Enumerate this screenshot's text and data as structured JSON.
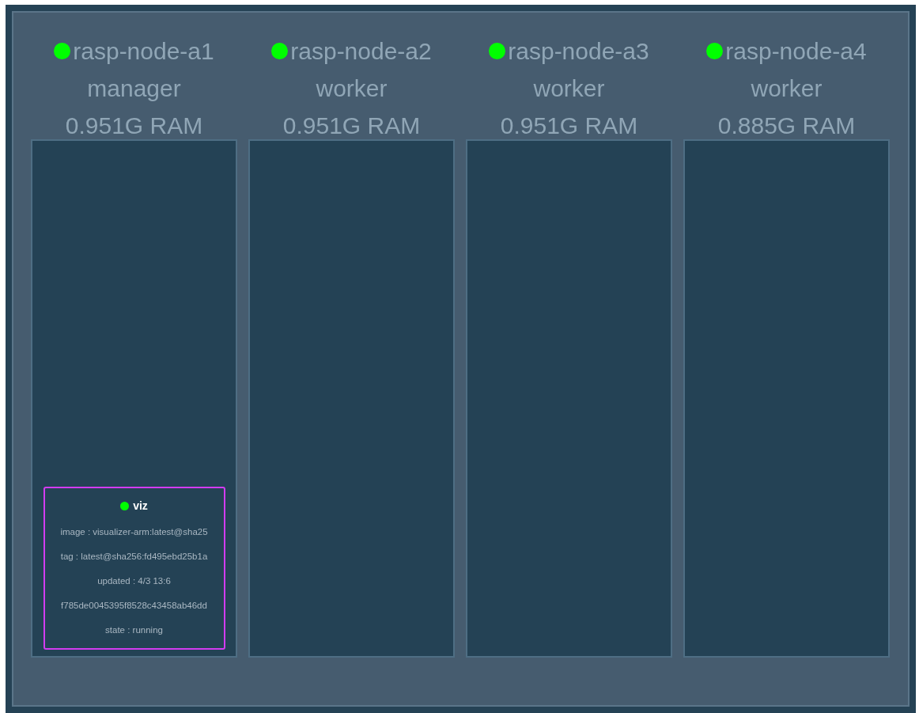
{
  "nodes": [
    {
      "name": "rasp-node-a1",
      "role": "manager",
      "ram": "0.951G RAM",
      "color": "#00ff00",
      "tasks": [
        {
          "name": "viz",
          "color": "#00ff00",
          "lines": [
            "image : visualizer-arm:latest@sha25",
            "tag : latest@sha256:fd495ebd25b1a",
            "updated : 4/3 13:6",
            "f785de0045395f8528c43458ab46dd",
            "state : running"
          ]
        }
      ]
    },
    {
      "name": "rasp-node-a2",
      "role": "worker",
      "ram": "0.951G RAM",
      "color": "#00ff00"
    },
    {
      "name": "rasp-node-a3",
      "role": "worker",
      "ram": "0.951G RAM",
      "color": "#00ff00"
    },
    {
      "name": "rasp-node-a4",
      "role": "worker",
      "ram": "0.885G RAM",
      "color": "#00ff00"
    }
  ]
}
